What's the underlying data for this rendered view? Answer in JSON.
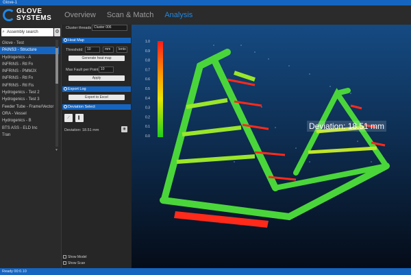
{
  "window": {
    "title": "Glove-1"
  },
  "brand": {
    "line1": "GLOVE",
    "line2": "SYSTEMS"
  },
  "tabs": [
    {
      "label": "Overview",
      "active": false
    },
    {
      "label": "Scan & Match",
      "active": false
    },
    {
      "label": "Analysis",
      "active": true
    }
  ],
  "sidebar": {
    "search_value": "Assembly search",
    "items": [
      {
        "label": "Glove - Test",
        "selected": false
      },
      {
        "label": "PAINS3 - Structure",
        "selected": true
      },
      {
        "label": "Hydrogenics - A",
        "selected": false
      },
      {
        "label": "INFRINS - Rtl Fn",
        "selected": false
      },
      {
        "label": "INFRINS - PMMJX",
        "selected": false
      },
      {
        "label": "INFRINS - Rtl Fn",
        "selected": false
      },
      {
        "label": "INFRINS - Rtl Fis",
        "selected": false
      },
      {
        "label": "Hydrogenics - Test 2",
        "selected": false
      },
      {
        "label": "Hydrogenics - Test 3",
        "selected": false
      },
      {
        "label": "Feeder Tube - Frame/Vector",
        "selected": false
      },
      {
        "label": "ORA - Vessel",
        "selected": false
      },
      {
        "label": "Hydrogenics - B",
        "selected": false
      },
      {
        "label": "BTS ASS - ELD Inc",
        "selected": false
      },
      {
        "label": "Tran",
        "selected": false
      }
    ]
  },
  "panel": {
    "cluster_label": "Cluster threads",
    "cluster_value": "Cluster 006",
    "section1": "Heat Map",
    "threshold_label": "Threshold",
    "threshold_value": "10",
    "unit1": "mm",
    "unit2": "lento",
    "generate_btn": "Generate heat map",
    "max_fault_label": "Max Fault per Point",
    "max_fault_value": "10",
    "apply_btn": "Apply",
    "section2": "Export Log",
    "export_btn": "Export to Excel",
    "section3": "Deviation Select",
    "deviation_readout": "Deviation: 18.51 mm",
    "show_model": "Show Model",
    "show_scan": "Show Scan"
  },
  "legend": {
    "ticks": [
      "1.0",
      "0.9",
      "0.8",
      "0.7",
      "0.6",
      "0.5",
      "0.4",
      "0.3",
      "0.2",
      "0.1",
      "0.0"
    ]
  },
  "viewport": {
    "deviation_label": "Deviation: 18.51 mm"
  },
  "status": {
    "text": "Ready 00:0.10"
  },
  "colors": {
    "accent": "#1565c0",
    "viewport_bg": "#0a1c35"
  }
}
